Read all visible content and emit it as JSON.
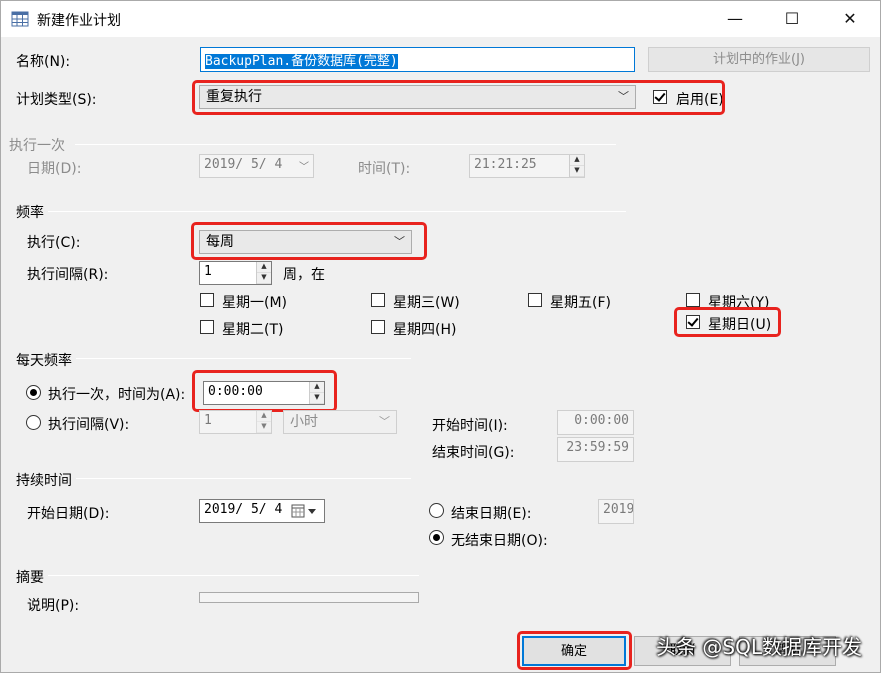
{
  "window": {
    "title": "新建作业计划",
    "minimize": "—",
    "maximize": "☐",
    "close": "✕"
  },
  "name": {
    "label": "名称(N):",
    "value": "BackupPlan.备份数据库(完整)",
    "jobs_button": "计划中的作业(J)"
  },
  "schedule_type": {
    "label": "计划类型(S):",
    "value": "重复执行",
    "enabled_label": "启用(E)",
    "enabled": true
  },
  "once": {
    "group": "执行一次",
    "date_label": "日期(D):",
    "date_value": "2019/ 5/ 4",
    "time_label": "时间(T):",
    "time_value": "21:21:25"
  },
  "frequency": {
    "group": "频率",
    "occurs_label": "执行(C):",
    "occurs_value": "每周",
    "recurs_label": "执行间隔(R):",
    "recurs_value": "1",
    "recurs_unit": "周，在",
    "days": [
      {
        "label": "星期一(M)",
        "checked": false
      },
      {
        "label": "星期三(W)",
        "checked": false
      },
      {
        "label": "星期五(F)",
        "checked": false
      },
      {
        "label": "星期六(Y)",
        "checked": false
      },
      {
        "label": "星期二(T)",
        "checked": false
      },
      {
        "label": "星期四(H)",
        "checked": false
      },
      {
        "label": "星期日(U)",
        "checked": true
      }
    ]
  },
  "daily": {
    "group": "每天频率",
    "once_label": "执行一次，时间为(A):",
    "once_value": "0:00:00",
    "every_label": "执行间隔(V):",
    "every_value": "1",
    "every_unit": "小时",
    "start_label": "开始时间(I):",
    "start_value": "0:00:00",
    "end_label": "结束时间(G):",
    "end_value": "23:59:59"
  },
  "duration": {
    "group": "持续时间",
    "start_label": "开始日期(D):",
    "start_value": "2019/ 5/ 4",
    "end_label": "结束日期(E):",
    "end_value": "2019",
    "noend_label": "无结束日期(O):"
  },
  "summary": {
    "group": "摘要",
    "desc_label": "说明(P):",
    "desc_value": ""
  },
  "buttons": {
    "ok": "确定",
    "cancel": "取消",
    "help": "帮助"
  },
  "watermark": "头条 @SQL数据库开发",
  "colors": {
    "highlight": "#e8231e",
    "selection": "#0078d7"
  }
}
